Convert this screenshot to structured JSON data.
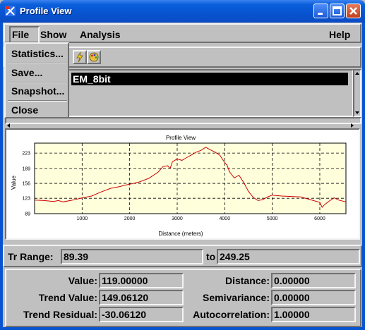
{
  "window": {
    "title": "Profile View"
  },
  "menubar": {
    "file": "File",
    "show": "Show",
    "analysis": "Analysis",
    "help": "Help"
  },
  "file_menu": {
    "items": [
      "Statistics...",
      "Save...",
      "Snapshot...",
      "Close"
    ]
  },
  "list": {
    "selected_item": "EM_8bit"
  },
  "chart_data": {
    "type": "line",
    "title": "Profile View",
    "xlabel": "Distance (meters)",
    "ylabel": "Value",
    "xlim": [
      0,
      6550
    ],
    "ylim": [
      89,
      245
    ],
    "xticks": [
      1000,
      2000,
      3000,
      4000,
      5000,
      6000
    ],
    "yticks": [
      89,
      123,
      156,
      189,
      223
    ],
    "grid": true,
    "background": "#ffffdc",
    "series": [
      {
        "color": "#cc0000",
        "x": [
          0,
          200,
          400,
          500,
          600,
          800,
          1000,
          1200,
          1400,
          1600,
          1800,
          1900,
          2000,
          2200,
          2400,
          2600,
          2700,
          2800,
          2850,
          2900,
          3000,
          3100,
          3200,
          3300,
          3400,
          3500,
          3600,
          3700,
          3800,
          3900,
          4000,
          4050,
          4100,
          4200,
          4300,
          4400,
          4500,
          4600,
          4700,
          4800,
          4900,
          5000,
          5200,
          5400,
          5600,
          5800,
          6000,
          6050,
          6100,
          6200,
          6300,
          6400,
          6550
        ],
        "y": [
          119,
          118,
          116,
          118,
          115,
          119,
          124,
          128,
          137,
          145,
          149,
          152,
          154,
          159,
          167,
          181,
          193,
          195,
          189,
          204,
          210,
          207,
          213,
          219,
          225,
          229,
          236,
          230,
          225,
          218,
          202,
          196,
          182,
          168,
          174,
          158,
          138,
          125,
          118,
          120,
          126,
          130,
          128,
          127,
          126,
          120,
          114,
          103,
          109,
          117,
          124,
          119,
          115
        ]
      }
    ]
  },
  "range": {
    "label": "Tr  Range:",
    "from": "89.39",
    "to_label": "to",
    "to": "249.25"
  },
  "stats": {
    "value_label": "Value:",
    "value": "119.00000",
    "trend_value_label": "Trend Value:",
    "trend_value": "149.06120",
    "trend_residual_label": "Trend Residual:",
    "trend_residual": "-30.06120",
    "distance_label": "Distance:",
    "distance": "0.00000",
    "semivariance_label": "Semivariance:",
    "semivariance": "0.00000",
    "autocorrelation_label": "Autocorrelation:",
    "autocorrelation": "1.00000"
  }
}
